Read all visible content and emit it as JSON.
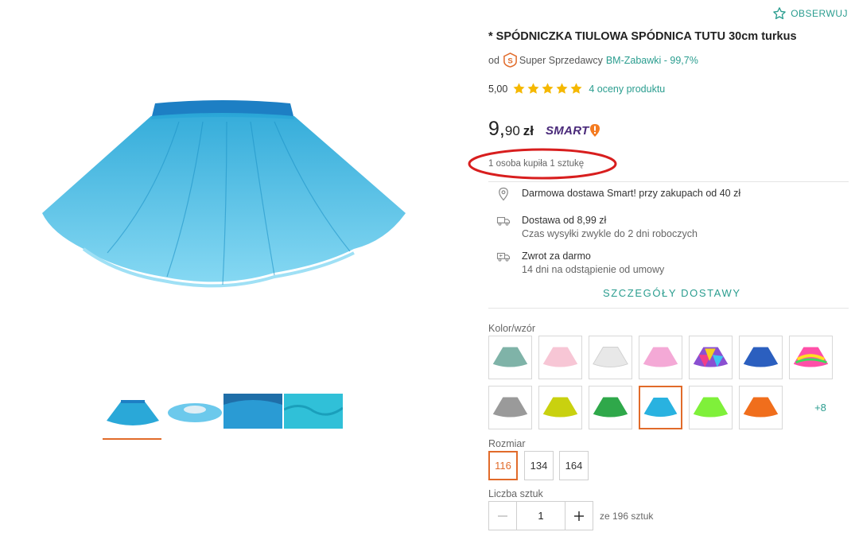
{
  "header": {
    "observe_label": "OBSERWUJ"
  },
  "product": {
    "title": "* SPÓDNICZKA TIULOWA SPÓDNICA TUTU 30cm turkus",
    "seller_prefix": "od",
    "seller_badge": "Super Sprzedawcy",
    "seller_link": "BM-Zabawki - 99,7%",
    "rating_value": "5,00",
    "stars": 5,
    "rating_link": "4 oceny produktu",
    "price_main": "9,",
    "price_cents": "90",
    "price_currency": "zł",
    "smart_label": "SMART",
    "buyers_text": "1 osoba kupiła 1 sztukę",
    "color": "#29b2e0"
  },
  "delivery": {
    "items": [
      {
        "icon": "location-pin-icon",
        "title": "Darmowa dostawa Smart! przy zakupach od 40 zł",
        "subtitle": ""
      },
      {
        "icon": "truck-icon",
        "title": "Dostawa od 8,99 zł",
        "subtitle": "Czas wysyłki zwykle do 2 dni roboczych"
      },
      {
        "icon": "return-truck-icon",
        "title": "Zwrot za darmo",
        "subtitle": "14 dni na odstąpienie od umowy"
      }
    ],
    "details_link": "SZCZEGÓŁY DOSTAWY"
  },
  "variants": {
    "color_label": "Kolor/wzór",
    "swatches_row1": [
      "#7fb3a8",
      "#f7c6d5",
      "#e8e8e8",
      "#f4a9d6",
      "rainbow",
      "#2b5fbf",
      "neon-rainbow"
    ],
    "swatches_row2": [
      "#9a9a9a",
      "#c9d10f",
      "#2fa84a",
      "#29b2e0",
      "#7ff03a",
      "#f06e1c"
    ],
    "selected_swatch_index_row2": 3,
    "more_label": "+8",
    "size_label": "Rozmiar",
    "sizes": [
      "116",
      "134",
      "164"
    ],
    "selected_size": "116",
    "quantity_label": "Liczba sztuk",
    "quantity_value": "1",
    "stock_text": "ze 196 sztuk"
  },
  "colors": {
    "accent": "#2a9d8f",
    "selection": "#e16b2a",
    "highlight_oval": "#d81e1e"
  }
}
